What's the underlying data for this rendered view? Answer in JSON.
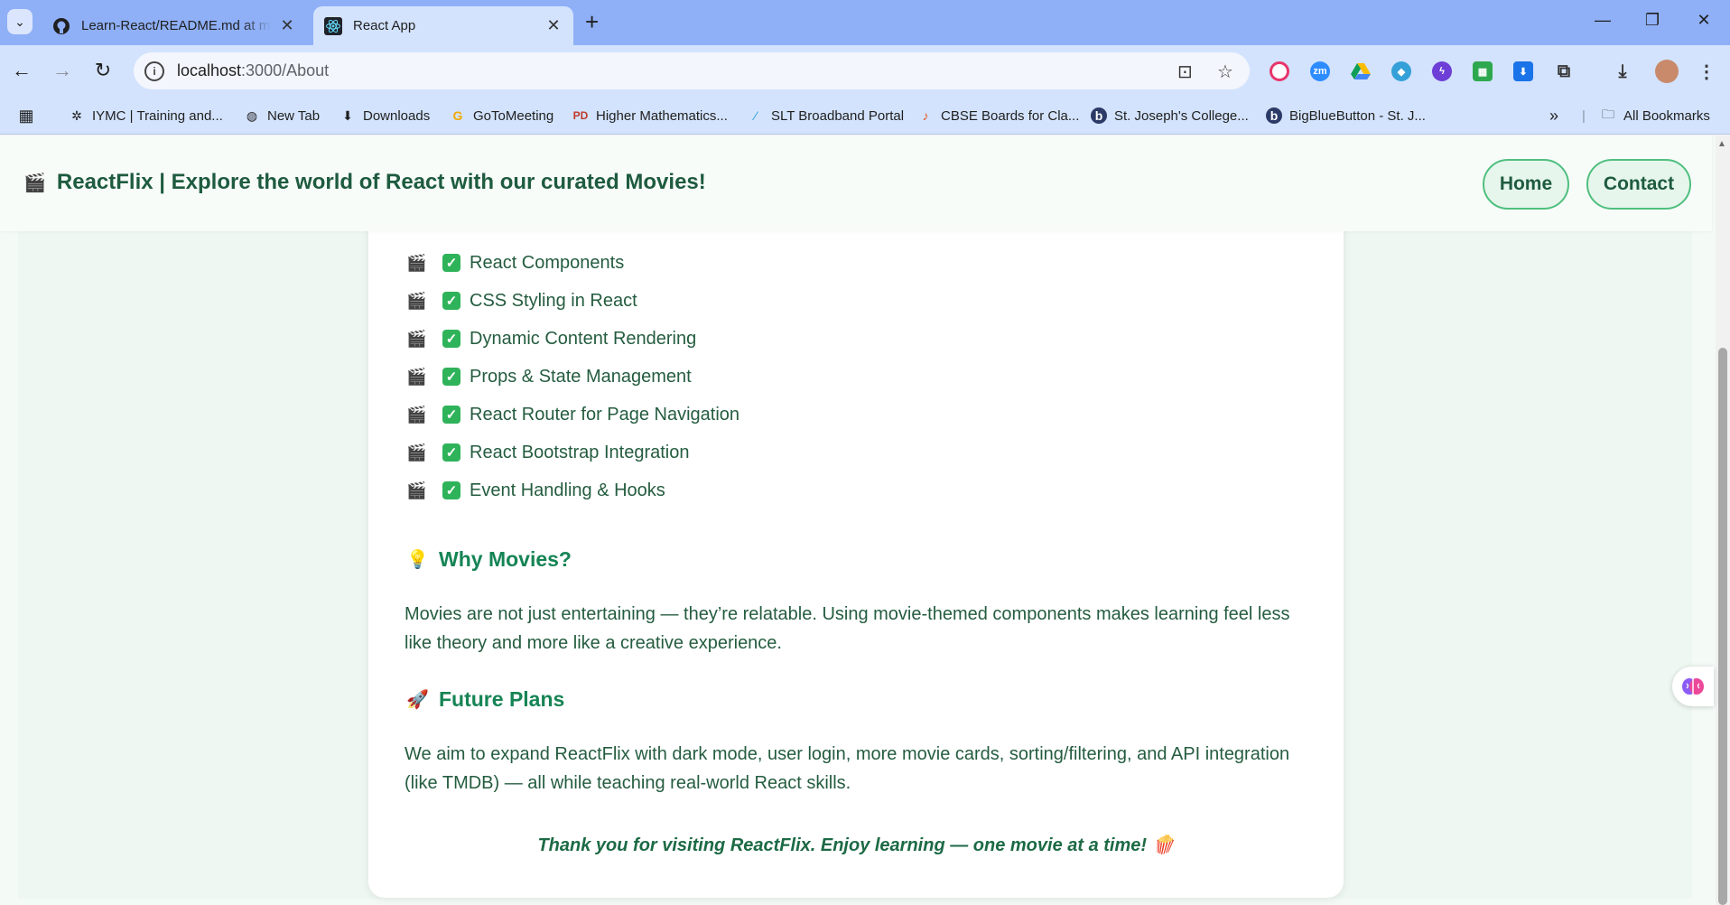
{
  "browser": {
    "tabs": [
      {
        "title": "Learn-React/README.md at main",
        "favicon": "github-icon",
        "active": false
      },
      {
        "title": "React App",
        "favicon": "react-icon",
        "active": true
      }
    ],
    "address": {
      "host": "localhost",
      "path": ":3000/About"
    },
    "bookmarks": [
      {
        "label": "IYMC | Training and...",
        "icon": "iymc-icon"
      },
      {
        "label": "New Tab",
        "icon": "globe-icon"
      },
      {
        "label": "Downloads",
        "icon": "download-icon"
      },
      {
        "label": "GoToMeeting",
        "icon": "gotomeeting-icon"
      },
      {
        "label": "Higher Mathematics...",
        "icon": "pd-icon"
      },
      {
        "label": "SLT Broadband Portal",
        "icon": "slt-icon"
      },
      {
        "label": "CBSE Boards for Cla...",
        "icon": "cbse-icon"
      },
      {
        "label": "St. Joseph's College...",
        "icon": "b-icon"
      },
      {
        "label": "BigBlueButton - St. J...",
        "icon": "b-icon"
      }
    ],
    "all_bookmarks": "All Bookmarks"
  },
  "site": {
    "brand_emoji": "🎬",
    "brand": "ReactFlix | Explore the world of React with our curated Movies!",
    "nav": {
      "home": "Home",
      "contact": "Contact"
    }
  },
  "features": {
    "bullet_emoji": "🎬",
    "check": "✓",
    "items": [
      "React Components",
      "CSS Styling in React",
      "Dynamic Content Rendering",
      "Props & State Management",
      "React Router for Page Navigation",
      "React Bootstrap Integration",
      "Event Handling & Hooks"
    ]
  },
  "why": {
    "emoji": "💡",
    "heading": "Why Movies?",
    "body": "Movies are not just entertaining — they’re relatable. Using movie-themed components makes learning feel less like theory and more like a creative experience."
  },
  "future": {
    "emoji": "🚀",
    "heading": "Future Plans",
    "body": "We aim to expand ReactFlix with dark mode, user login, more movie cards, sorting/filtering, and API integration (like TMDB) — all while teaching real-world React skills."
  },
  "thanks": {
    "text": "Thank you for visiting ReactFlix. Enjoy learning — one movie at a time!",
    "emoji": "🍿"
  }
}
